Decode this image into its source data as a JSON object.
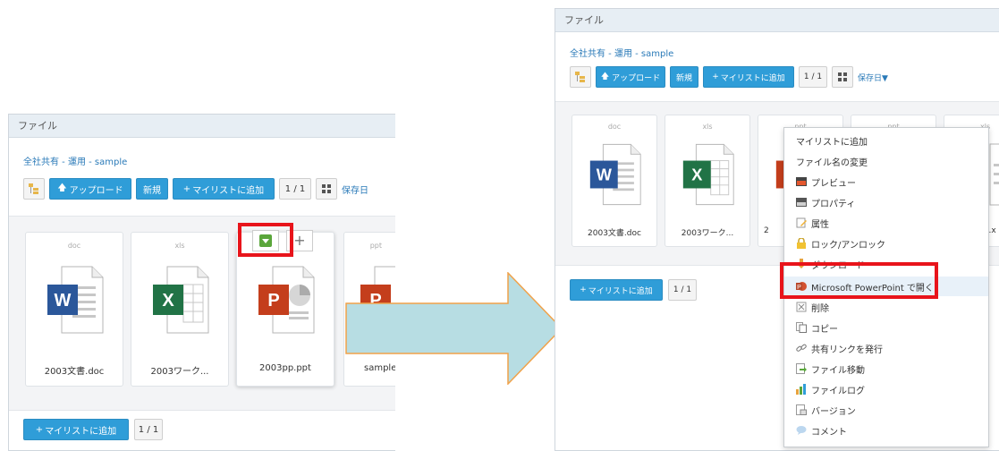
{
  "left": {
    "header": "ファイル",
    "breadcrumb": "全社共有 - 運用 - sample",
    "toolbar": {
      "upload": "アップロード",
      "new": "新規",
      "mylist": "マイリストに追加",
      "page": "1 / 1",
      "sort": "保存日"
    },
    "cards": [
      {
        "ext": "doc",
        "name": "2003文書.doc"
      },
      {
        "ext": "xls",
        "name": "2003ワーク..."
      },
      {
        "ext": "",
        "name": "2003pp.ppt"
      },
      {
        "ext": "ppt",
        "name": "sample"
      }
    ],
    "footer": {
      "mylist": "マイリストに追加",
      "page": "1 / 1"
    }
  },
  "right": {
    "header": "ファイル",
    "breadcrumb": "全社共有 - 運用 - sample",
    "toolbar": {
      "upload": "アップロード",
      "new": "新規",
      "mylist": "マイリストに追加",
      "page": "1 / 1",
      "sort": "保存日"
    },
    "cards": [
      {
        "ext": "doc",
        "name": "2003文書.doc"
      },
      {
        "ext": "xls",
        "name": "2003ワーク..."
      },
      {
        "ext": "ppt",
        "name": "2"
      },
      {
        "ext": "ppt",
        "name": ""
      },
      {
        "ext": "xls",
        "name": "e.x"
      }
    ],
    "footer": {
      "mylist": "マイリストに追加",
      "page": "1 / 1"
    }
  },
  "context_menu": [
    {
      "label": "マイリストに追加",
      "icon": "none"
    },
    {
      "label": "ファイル名の変更",
      "icon": "none"
    },
    {
      "label": "プレビュー",
      "icon": "preview-icon"
    },
    {
      "label": "プロパティ",
      "icon": "properties-icon"
    },
    {
      "label": "属性",
      "icon": "attribute-icon"
    },
    {
      "label": "ロック/アンロック",
      "icon": "lock-icon"
    },
    {
      "label": "ダウンロード",
      "icon": "download-icon"
    },
    {
      "label": "Microsoft PowerPoint で開く",
      "icon": "powerpoint-icon"
    },
    {
      "label": "削除",
      "icon": "delete-icon"
    },
    {
      "label": "コピー",
      "icon": "copy-icon"
    },
    {
      "label": "共有リンクを発行",
      "icon": "link-icon"
    },
    {
      "label": "ファイル移動",
      "icon": "move-icon"
    },
    {
      "label": "ファイルログ",
      "icon": "log-icon"
    },
    {
      "label": "バージョン",
      "icon": "version-icon"
    },
    {
      "label": "コメント",
      "icon": "comment-icon"
    }
  ],
  "colors": {
    "accent": "#2f9dd8",
    "highlight": "#e8141b",
    "arrow": "#b7dde3",
    "word": "#2b579a",
    "excel": "#217346",
    "powerpoint": "#c43e1c"
  }
}
